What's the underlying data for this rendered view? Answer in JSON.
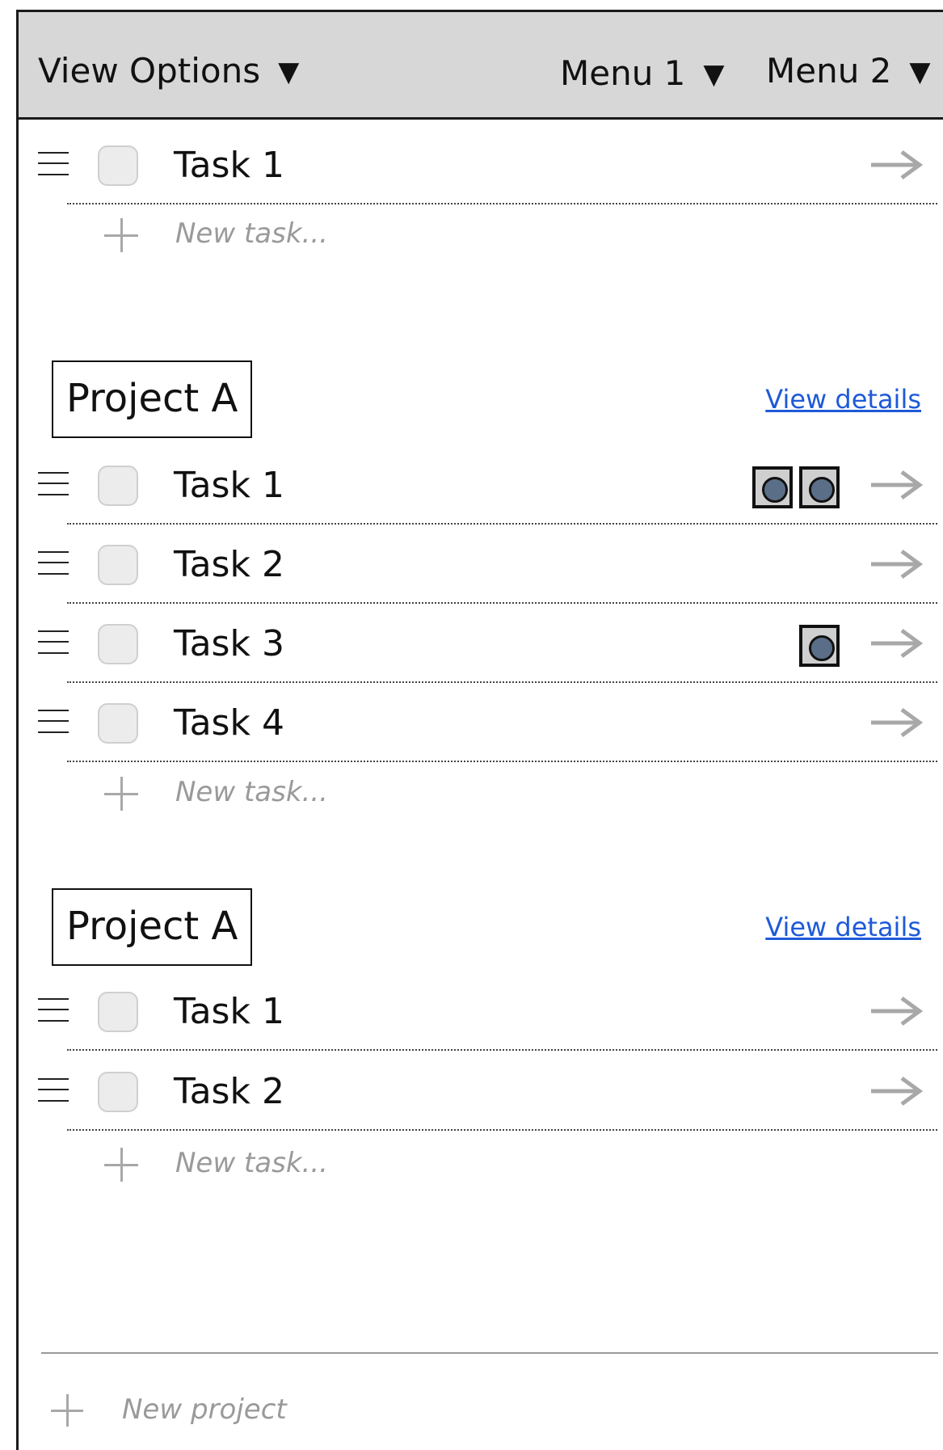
{
  "header": {
    "view_options": "View Options",
    "menu1": "Menu 1",
    "menu2": "Menu 2",
    "caret": "▼"
  },
  "inbox": {
    "tasks": [
      {
        "label": "Task 1",
        "badges": 0
      }
    ],
    "new_task": "New task..."
  },
  "projects": [
    {
      "title": "Project A",
      "details_link": "View details",
      "tasks": [
        {
          "label": "Task 1",
          "badges": 2
        },
        {
          "label": "Task 2",
          "badges": 0
        },
        {
          "label": "Task 3",
          "badges": 1
        },
        {
          "label": "Task 4",
          "badges": 0
        }
      ],
      "new_task": "New task..."
    },
    {
      "title": "Project A",
      "details_link": "View details",
      "tasks": [
        {
          "label": "Task 1",
          "badges": 0
        },
        {
          "label": "Task 2",
          "badges": 0
        }
      ],
      "new_task": "New task..."
    }
  ],
  "footer": {
    "new_project": "New project"
  },
  "colors": {
    "header_bg": "#d7d7d7",
    "link": "#1e5ad8",
    "badge_dot": "#5b6e88",
    "placeholder": "#9a9a9a"
  },
  "icons": {
    "row_handle": "hamburger-icon",
    "row_open": "arrow-right-icon",
    "add": "plus-icon",
    "badge": "record-icon"
  }
}
